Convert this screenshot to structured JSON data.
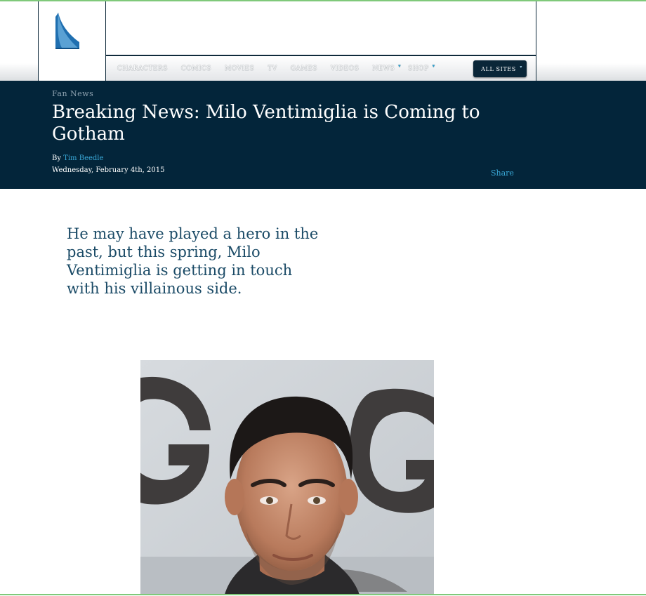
{
  "nav": {
    "items": [
      {
        "label": "CHARACTERS",
        "has_dropdown": false
      },
      {
        "label": "COMICS",
        "has_dropdown": false
      },
      {
        "label": "MOVIES",
        "has_dropdown": false
      },
      {
        "label": "TV",
        "has_dropdown": false
      },
      {
        "label": "GAMES",
        "has_dropdown": false
      },
      {
        "label": "VIDEOS",
        "has_dropdown": false
      },
      {
        "label": "NEWS",
        "has_dropdown": true
      },
      {
        "label": "SHOP",
        "has_dropdown": true
      }
    ],
    "all_sites_label": "ALL SITES",
    "caret_glyph": "▾"
  },
  "article": {
    "category": "Fan News",
    "title": "Breaking News: Milo Ventimiglia is Coming to Gotham",
    "by_label": "By",
    "author": "Tim Beedle",
    "date": "Wednesday, February 4th, 2015",
    "share_label": "Share",
    "intro": "He may have played a hero in the past, but this spring, Milo Ventimiglia is getting in touch with his villainous side."
  },
  "colors": {
    "hero_bg": "#03253a",
    "link_blue": "#3aa9d8",
    "intro_text": "#1a4a66",
    "logo_blue": "#1f6fb0"
  }
}
